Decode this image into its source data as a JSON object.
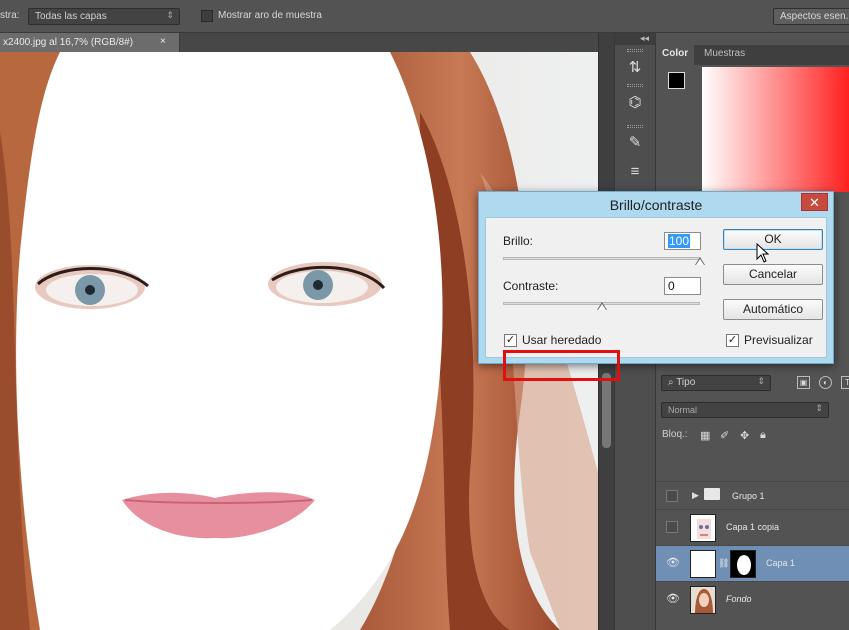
{
  "options_bar": {
    "sample_label": "stra:",
    "sample_value": "Todas las capas",
    "show_ring_label": "Mostrar aro de muestra",
    "workspace_button": "Aspectos esen..."
  },
  "document_tab": {
    "title": "x2400.jpg al 16,7% (RGB/8#)",
    "close": "×"
  },
  "toolstrip": {
    "collapse": "◂◂"
  },
  "color_panel": {
    "tabs": [
      "Color",
      "Muestras"
    ],
    "foreground": "#000000",
    "background": "#ffffff"
  },
  "layers_panel": {
    "filter_label": "⌕ Tipo",
    "blend_mode": "Normal",
    "lock_label": "Bloq.:",
    "layers": [
      {
        "name": "Grupo 1",
        "visible": false,
        "type": "group"
      },
      {
        "name": "Capa 1 copia",
        "visible": false,
        "type": "layer"
      },
      {
        "name": "Capa 1",
        "visible": true,
        "type": "layer",
        "selected": true
      },
      {
        "name": "Fondo",
        "visible": true,
        "type": "background"
      }
    ]
  },
  "dialog": {
    "title": "Brillo/contraste",
    "close": "✕",
    "brightness_label": "Brillo:",
    "brightness_value": "100",
    "brightness_level": 1.0,
    "contrast_label": "Contraste:",
    "contrast_value": "0",
    "contrast_level": 0.5,
    "use_legacy_label": "Usar heredado",
    "use_legacy_checked": true,
    "ok_label": "OK",
    "cancel_label": "Cancelar",
    "auto_label": "Automático",
    "preview_label": "Previsualizar",
    "preview_checked": true
  }
}
